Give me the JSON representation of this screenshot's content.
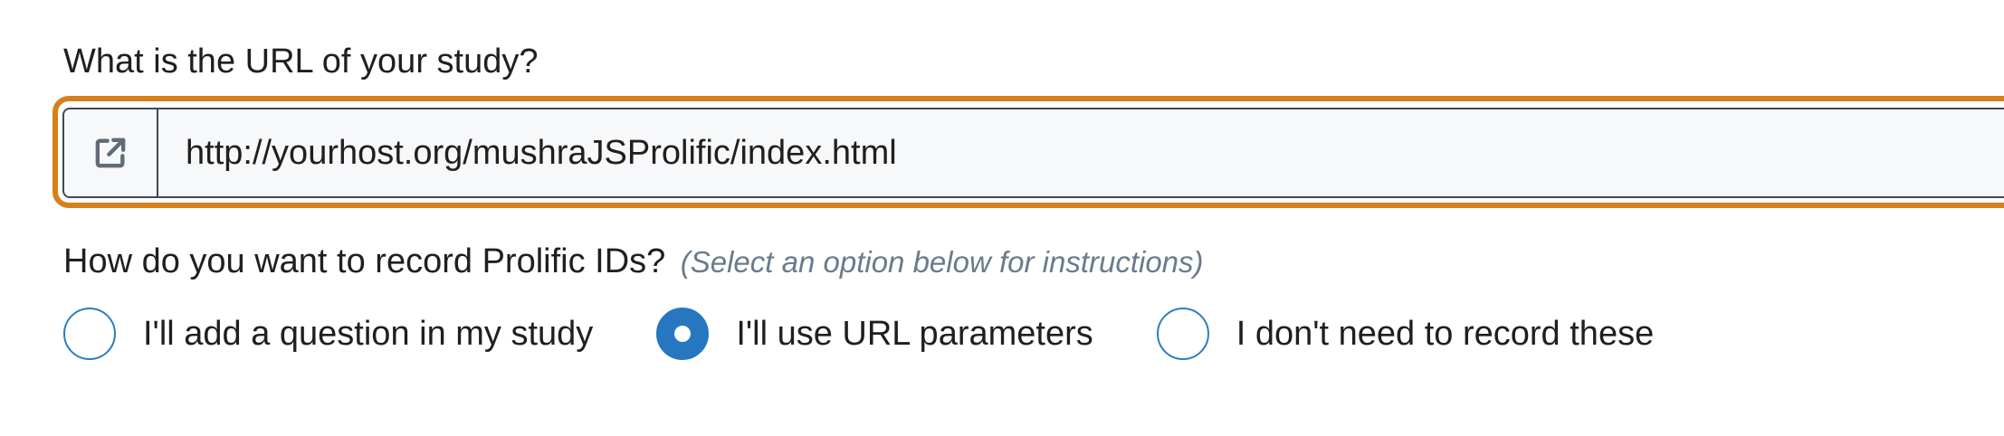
{
  "url_section": {
    "label": "What is the URL of your study?",
    "input_value": "http://yourhost.org/mushraJSProlific/index.html",
    "addon_icon": "external-link-icon"
  },
  "prolific_ids": {
    "label": "How do you want to record Prolific IDs?",
    "hint": "(Select an option below for instructions)",
    "options": [
      {
        "label": "I'll add a question in my study",
        "selected": false
      },
      {
        "label": "I'll use URL parameters",
        "selected": true
      },
      {
        "label": "I don't need to record these",
        "selected": false
      }
    ]
  },
  "colors": {
    "focus_ring": "#d68019",
    "radio_accent": "#2677c0",
    "hint_text": "#6b7a8c"
  }
}
